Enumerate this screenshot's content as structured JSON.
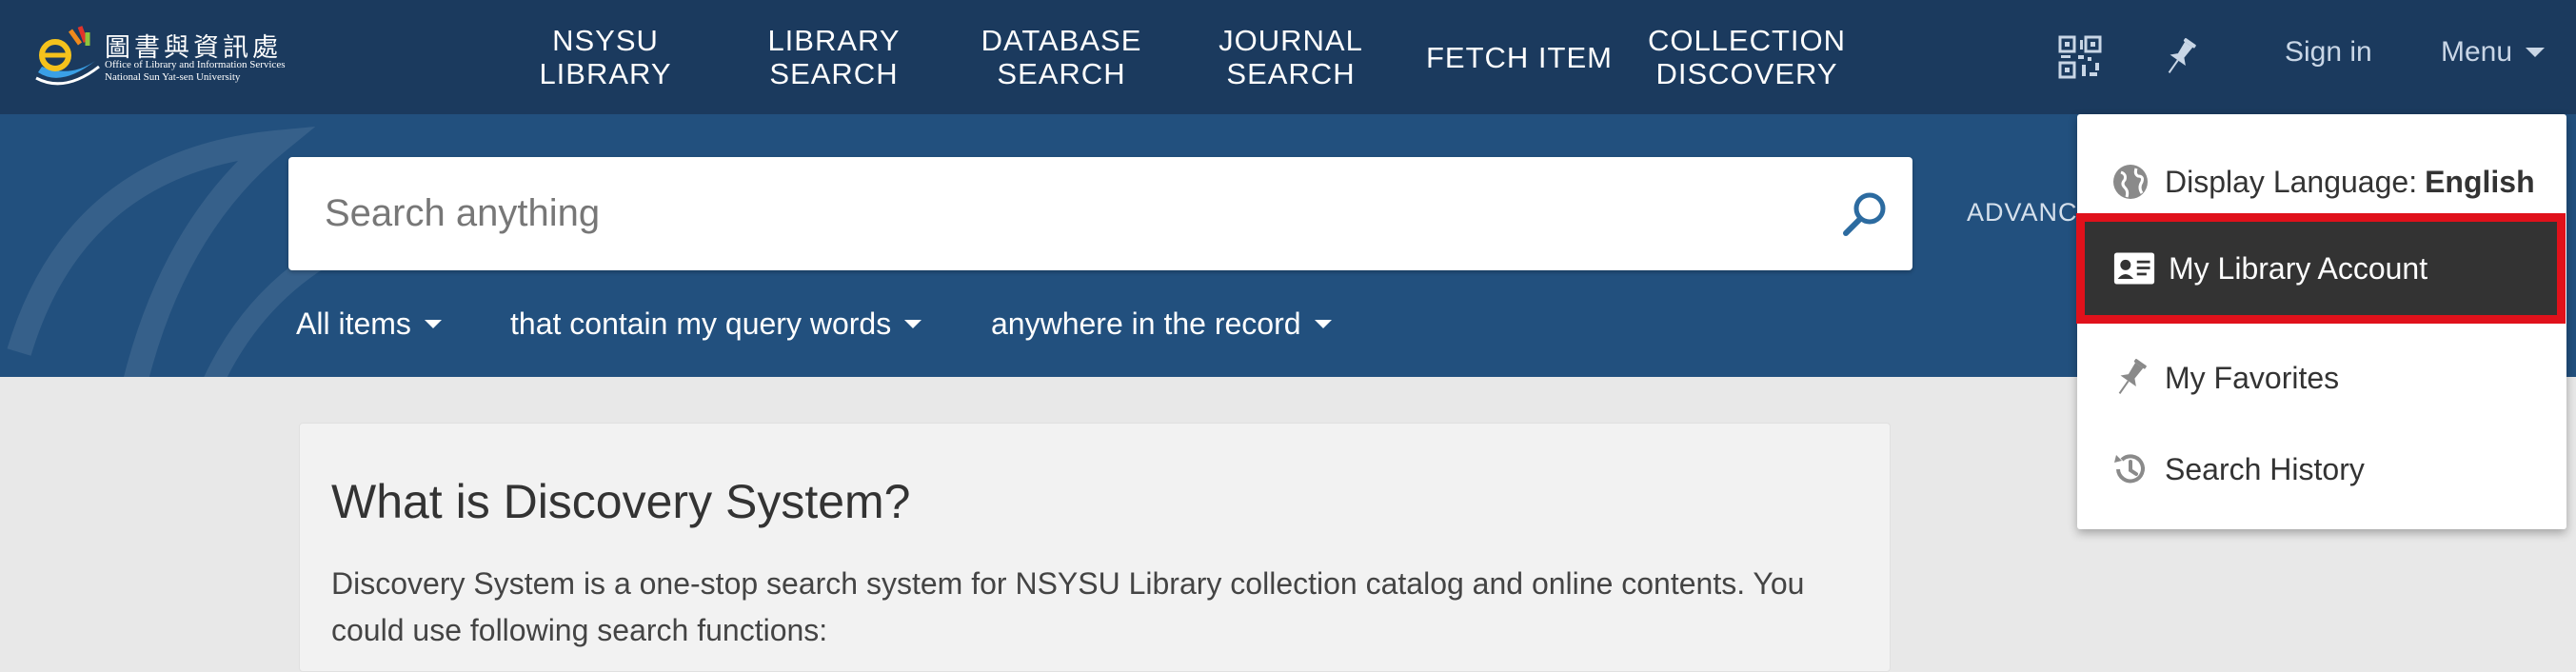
{
  "logo": {
    "title_cn": "圖書與資訊處",
    "subtitle_en_line1": "Office of Library and Information Services",
    "subtitle_en_line2": "National Sun Yat-sen University"
  },
  "nav": {
    "items": [
      {
        "label": "NSYSU\nLIBRARY"
      },
      {
        "label": "LIBRARY\nSEARCH"
      },
      {
        "label": "DATABASE\nSEARCH"
      },
      {
        "label": "JOURNAL\nSEARCH"
      },
      {
        "label": "FETCH ITEM"
      },
      {
        "label": "COLLECTION\nDISCOVERY"
      }
    ],
    "qr_icon": "qr-code-icon",
    "pin_icon": "pushpin-icon",
    "sign_in": "Sign in",
    "menu": "Menu"
  },
  "search": {
    "placeholder": "Search anything",
    "advanced": "ADVANCED",
    "filters": {
      "scope": "All items",
      "precision": "that contain my query words",
      "field": "anywhere in the record"
    }
  },
  "card": {
    "title": "What is Discovery System?",
    "body": "Discovery System is a one-stop search system for NSYSU Library collection catalog and online contents. You could use following search functions:"
  },
  "dropdown": {
    "language_label": "Display Language:",
    "language_value": "English",
    "account": "My Library Account",
    "favorites": "My Favorites",
    "history": "Search History"
  },
  "colors": {
    "topbar": "#1b3a5e",
    "searchband": "#22507e",
    "highlight": "#e0111b"
  }
}
